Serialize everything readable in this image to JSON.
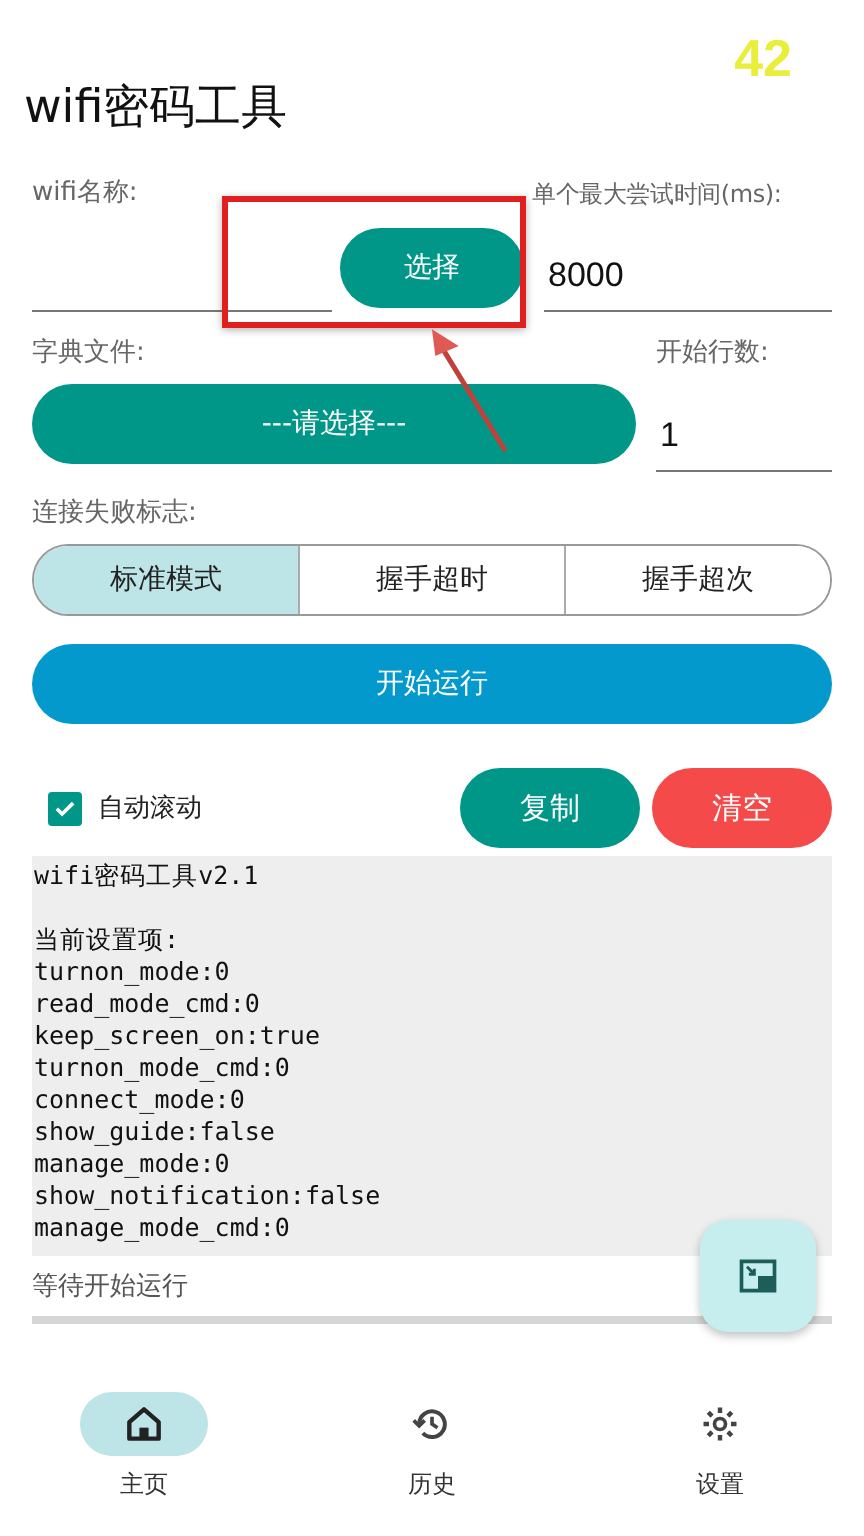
{
  "overlay_counter": "42",
  "title": "wifi密码工具",
  "wifi": {
    "label": "wifi名称:",
    "button": "选择"
  },
  "timeout": {
    "label": "单个最大尝试时间(ms):",
    "value": "8000"
  },
  "dictionary": {
    "label": "字典文件:",
    "button": "---请选择---"
  },
  "start_line": {
    "label": "开始行数:",
    "value": "1"
  },
  "fail_flag": {
    "label": "连接失败标志:",
    "options": [
      {
        "label": "标准模式",
        "selected": true
      },
      {
        "label": "握手超时",
        "selected": false
      },
      {
        "label": "握手超次",
        "selected": false
      }
    ]
  },
  "run_button": "开始运行",
  "auto_scroll": {
    "label": "自动滚动",
    "checked": true
  },
  "copy_button": "复制",
  "clear_button": "清空",
  "log": {
    "heading": "wifi密码工具v2.1",
    "lines": [
      "当前设置项:",
      "turnon_mode:0",
      "read_mode_cmd:0",
      "keep_screen_on:true",
      "turnon_mode_cmd:0",
      "connect_mode:0",
      "show_guide:false",
      "manage_mode:0",
      "show_notification:false",
      "manage_mode_cmd:0"
    ]
  },
  "status": "等待开始运行",
  "annotation": {
    "kind": "frame_arrow"
  },
  "nav": [
    {
      "label": "主页",
      "selected": true
    },
    {
      "label": "历史",
      "selected": false
    },
    {
      "label": "设置",
      "selected": false
    }
  ]
}
